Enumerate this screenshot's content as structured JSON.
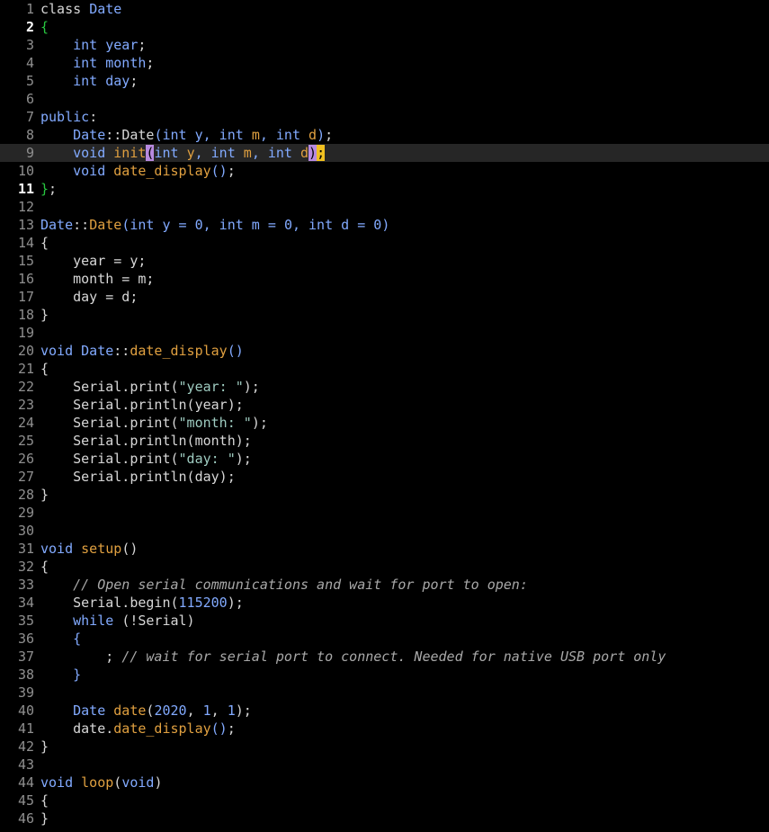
{
  "editor": {
    "colors": {
      "background": "#000000",
      "current_line": "#262626",
      "line_number": "#8f8f8f",
      "keyword_type": "#82aaff",
      "function_name": "#e0a040",
      "string": "#9ecbc0",
      "comment": "#a8a8a8",
      "brace": "#28c840",
      "paren_match": "#b78ae0",
      "semicolon_highlight": "#f0c020"
    },
    "current_line_number": 9,
    "lines": [
      {
        "n": "1",
        "tokens": [
          [
            "kw",
            "class "
          ],
          [
            "type",
            "Date"
          ]
        ]
      },
      {
        "n": "2",
        "active": true,
        "tokens": [
          [
            "brace",
            "{"
          ]
        ]
      },
      {
        "n": "3",
        "tokens": [
          [
            "id",
            "    "
          ],
          [
            "type",
            "int "
          ],
          [
            "type",
            "year"
          ],
          [
            "punc",
            ";"
          ]
        ]
      },
      {
        "n": "4",
        "tokens": [
          [
            "id",
            "    "
          ],
          [
            "type",
            "int "
          ],
          [
            "type",
            "month"
          ],
          [
            "punc",
            ";"
          ]
        ]
      },
      {
        "n": "5",
        "tokens": [
          [
            "id",
            "    "
          ],
          [
            "type",
            "int "
          ],
          [
            "type",
            "day"
          ],
          [
            "punc",
            ";"
          ]
        ]
      },
      {
        "n": "6",
        "tokens": []
      },
      {
        "n": "7",
        "tokens": [
          [
            "type",
            "public"
          ],
          [
            "punc",
            ":"
          ]
        ]
      },
      {
        "n": "8",
        "tokens": [
          [
            "id",
            "    "
          ],
          [
            "type",
            "Date"
          ],
          [
            "punc",
            "::"
          ],
          [
            "id",
            "Date"
          ],
          [
            "type",
            "(int y, int "
          ],
          [
            "fn",
            "m"
          ],
          [
            "type",
            ", int "
          ],
          [
            "fn",
            "d"
          ],
          [
            "type",
            ")"
          ],
          [
            "punc",
            ";"
          ]
        ]
      },
      {
        "n": "9",
        "current": true,
        "tokens": [
          [
            "id",
            "    "
          ],
          [
            "type",
            "void "
          ],
          [
            "fn",
            "init"
          ],
          [
            "match-paren",
            "("
          ],
          [
            "type",
            "int "
          ],
          [
            "fn",
            "y"
          ],
          [
            "type",
            ", int "
          ],
          [
            "fn",
            "m"
          ],
          [
            "type",
            ", int "
          ],
          [
            "fn",
            "d"
          ],
          [
            "match-paren",
            ")"
          ],
          [
            "match-semi",
            ";"
          ]
        ]
      },
      {
        "n": "10",
        "tokens": [
          [
            "id",
            "    "
          ],
          [
            "type",
            "void "
          ],
          [
            "fn",
            "date_display"
          ],
          [
            "type",
            "()"
          ],
          [
            "punc",
            ";"
          ]
        ]
      },
      {
        "n": "11",
        "active": true,
        "tokens": [
          [
            "brace",
            "}"
          ],
          [
            "punc",
            ";"
          ]
        ]
      },
      {
        "n": "12",
        "tokens": []
      },
      {
        "n": "13",
        "tokens": [
          [
            "type",
            "Date"
          ],
          [
            "punc",
            "::"
          ],
          [
            "fn",
            "Date"
          ],
          [
            "type",
            "(int y = "
          ],
          [
            "num",
            "0"
          ],
          [
            "type",
            ", int m = "
          ],
          [
            "num",
            "0"
          ],
          [
            "type",
            ", int d = "
          ],
          [
            "num",
            "0"
          ],
          [
            "type",
            ")"
          ]
        ]
      },
      {
        "n": "14",
        "tokens": [
          [
            "punc",
            "{"
          ]
        ]
      },
      {
        "n": "15",
        "tokens": [
          [
            "id",
            "    year = y;"
          ]
        ]
      },
      {
        "n": "16",
        "tokens": [
          [
            "id",
            "    month = m;"
          ]
        ]
      },
      {
        "n": "17",
        "tokens": [
          [
            "id",
            "    day = d;"
          ]
        ]
      },
      {
        "n": "18",
        "tokens": [
          [
            "punc",
            "}"
          ]
        ]
      },
      {
        "n": "19",
        "tokens": []
      },
      {
        "n": "20",
        "tokens": [
          [
            "type",
            "void "
          ],
          [
            "type",
            "Date"
          ],
          [
            "punc",
            "::"
          ],
          [
            "fn",
            "date_display"
          ],
          [
            "type",
            "()"
          ]
        ]
      },
      {
        "n": "21",
        "tokens": [
          [
            "punc",
            "{"
          ]
        ]
      },
      {
        "n": "22",
        "tokens": [
          [
            "id",
            "    Serial.print("
          ],
          [
            "str",
            "\"year: \""
          ],
          [
            "id",
            ");"
          ]
        ]
      },
      {
        "n": "23",
        "tokens": [
          [
            "id",
            "    Serial.println(year);"
          ]
        ]
      },
      {
        "n": "24",
        "tokens": [
          [
            "id",
            "    Serial.print("
          ],
          [
            "str",
            "\"month: \""
          ],
          [
            "id",
            ");"
          ]
        ]
      },
      {
        "n": "25",
        "tokens": [
          [
            "id",
            "    Serial.println(month);"
          ]
        ]
      },
      {
        "n": "26",
        "tokens": [
          [
            "id",
            "    Serial.print("
          ],
          [
            "str",
            "\"day: \""
          ],
          [
            "id",
            ");"
          ]
        ]
      },
      {
        "n": "27",
        "tokens": [
          [
            "id",
            "    Serial.println(day);"
          ]
        ]
      },
      {
        "n": "28",
        "tokens": [
          [
            "punc",
            "}"
          ]
        ]
      },
      {
        "n": "29",
        "tokens": []
      },
      {
        "n": "30",
        "tokens": []
      },
      {
        "n": "31",
        "tokens": [
          [
            "type",
            "void "
          ],
          [
            "fn",
            "setup"
          ],
          [
            "id",
            "()"
          ]
        ]
      },
      {
        "n": "32",
        "tokens": [
          [
            "punc",
            "{"
          ]
        ]
      },
      {
        "n": "33",
        "tokens": [
          [
            "id",
            "    "
          ],
          [
            "cmt",
            "// Open serial communications and wait for port to open:"
          ]
        ]
      },
      {
        "n": "34",
        "tokens": [
          [
            "id",
            "    Serial.begin("
          ],
          [
            "num",
            "115200"
          ],
          [
            "id",
            ");"
          ]
        ]
      },
      {
        "n": "35",
        "tokens": [
          [
            "id",
            "    "
          ],
          [
            "type",
            "while "
          ],
          [
            "id",
            "(!Serial)"
          ]
        ]
      },
      {
        "n": "36",
        "tokens": [
          [
            "id",
            "    "
          ],
          [
            "type",
            "{"
          ]
        ]
      },
      {
        "n": "37",
        "tokens": [
          [
            "id",
            "        ; "
          ],
          [
            "cmt",
            "// wait for serial port to connect. Needed for native USB port only"
          ]
        ]
      },
      {
        "n": "38",
        "tokens": [
          [
            "id",
            "    "
          ],
          [
            "type",
            "}"
          ]
        ]
      },
      {
        "n": "39",
        "tokens": []
      },
      {
        "n": "40",
        "tokens": [
          [
            "id",
            "    "
          ],
          [
            "type",
            "Date "
          ],
          [
            "fn",
            "date"
          ],
          [
            "id",
            "("
          ],
          [
            "num",
            "2020"
          ],
          [
            "id",
            ", "
          ],
          [
            "num",
            "1"
          ],
          [
            "id",
            ", "
          ],
          [
            "num",
            "1"
          ],
          [
            "id",
            ");"
          ]
        ]
      },
      {
        "n": "41",
        "tokens": [
          [
            "id",
            "    date."
          ],
          [
            "fn",
            "date_display"
          ],
          [
            "type",
            "()"
          ],
          [
            "id",
            ";"
          ]
        ]
      },
      {
        "n": "42",
        "tokens": [
          [
            "punc",
            "}"
          ]
        ]
      },
      {
        "n": "43",
        "tokens": []
      },
      {
        "n": "44",
        "tokens": [
          [
            "type",
            "void "
          ],
          [
            "fn",
            "loop"
          ],
          [
            "id",
            "("
          ],
          [
            "type",
            "void"
          ],
          [
            "id",
            ")"
          ]
        ]
      },
      {
        "n": "45",
        "tokens": [
          [
            "punc",
            "{"
          ]
        ]
      },
      {
        "n": "46",
        "tokens": [
          [
            "punc",
            "}"
          ]
        ]
      }
    ]
  }
}
